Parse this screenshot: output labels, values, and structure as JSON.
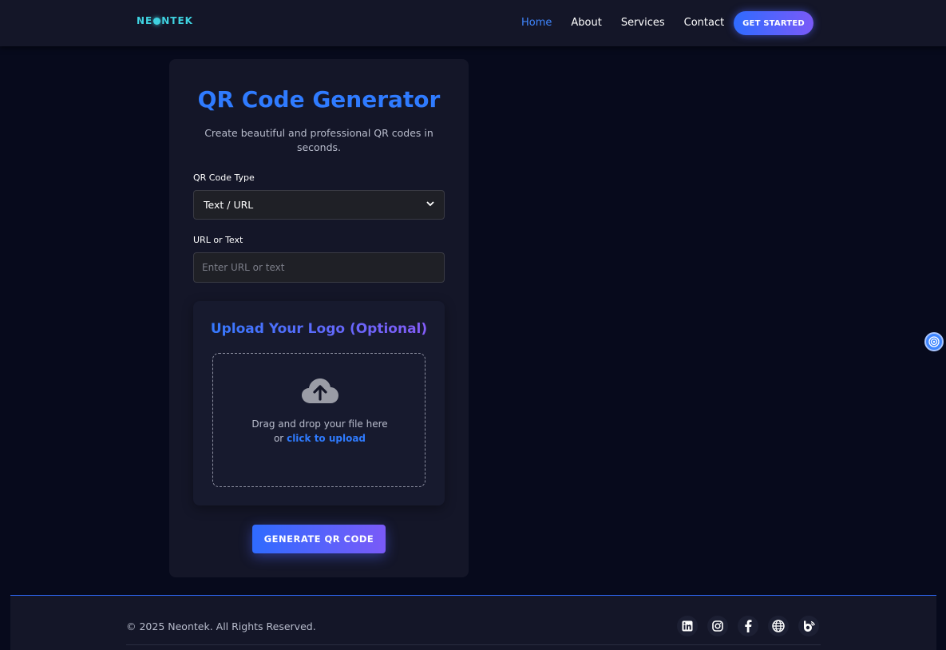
{
  "nav": {
    "logo": "NEONTEK",
    "links": [
      {
        "label": "Home",
        "active": true
      },
      {
        "label": "About",
        "active": false
      },
      {
        "label": "Services",
        "active": false
      },
      {
        "label": "Contact",
        "active": false
      }
    ],
    "cta": "GET STARTED"
  },
  "card": {
    "title": "QR Code Generator",
    "subtitle": "Create beautiful and professional QR codes in seconds.",
    "type_label": "QR Code Type",
    "type_value": "Text / URL",
    "input_label": "URL or Text",
    "input_placeholder": "Enter URL or text",
    "upload": {
      "title": "Upload Your Logo (Optional)",
      "drop_text": "Drag and drop your file here",
      "or_text": "or",
      "link_text": "click to upload"
    },
    "generate_button": "GENERATE QR CODE"
  },
  "footer": {
    "copyright": "© 2025 Neontek. All Rights Reserved.",
    "socials": [
      "linkedin-icon",
      "instagram-icon",
      "facebook-icon",
      "globe-icon",
      "blog-icon"
    ]
  },
  "colors": {
    "background": "#070a1c",
    "panel": "#141628",
    "accent": "#2f7bff",
    "accent_purple": "#7a5af8",
    "logo": "#3fd2e0"
  }
}
